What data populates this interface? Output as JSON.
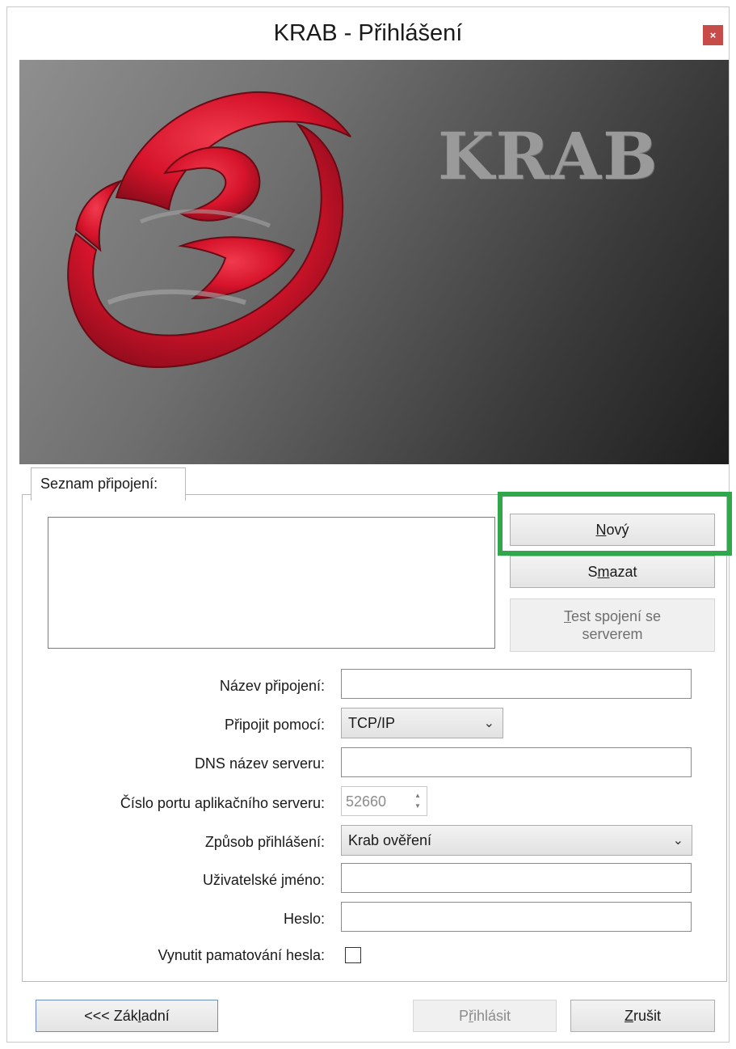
{
  "window": {
    "title": "KRAB - Přihlášení",
    "close_glyph": "×"
  },
  "banner": {
    "wordmark": "KRAB",
    "logo_color": "#d6142b"
  },
  "tab": {
    "label": "Seznam připojení:"
  },
  "connection_list": {
    "items": []
  },
  "buttons": {
    "new_label": "Nový",
    "new_mnemonic": "N",
    "delete_prefix": "S",
    "delete_mnemonic": "m",
    "delete_suffix": "azat",
    "test_mnemonic": "T",
    "test_line1_rest": "est spojení se",
    "test_line2": "serverem"
  },
  "form": {
    "connection_name_label": "Název připojení:",
    "connection_name_value": "",
    "connect_via_label": "Připojit pomocí:",
    "connect_via_value": "TCP/IP",
    "dns_label": "DNS název serveru:",
    "dns_value": "",
    "port_label": "Číslo portu aplikačního serveru:",
    "port_value": "52660",
    "login_method_label": "Způsob přihlášení:",
    "login_method_value": "Krab ověření",
    "username_label": "Uživatelské jméno:",
    "username_value": "",
    "password_label": "Heslo:",
    "password_value": "",
    "remember_label": "Vynutit pamatování hesla:",
    "remember_checked": false
  },
  "footer": {
    "basic_prefix": "<<< Zák",
    "basic_mnemonic": "l",
    "basic_suffix": "adní",
    "login_prefix": "P",
    "login_mnemonic": "ř",
    "login_suffix": "ihlásit",
    "cancel_mnemonic": "Z",
    "cancel_suffix": "rušit"
  },
  "colors": {
    "highlight": "#2fa74a",
    "close_button": "#c74b48"
  }
}
